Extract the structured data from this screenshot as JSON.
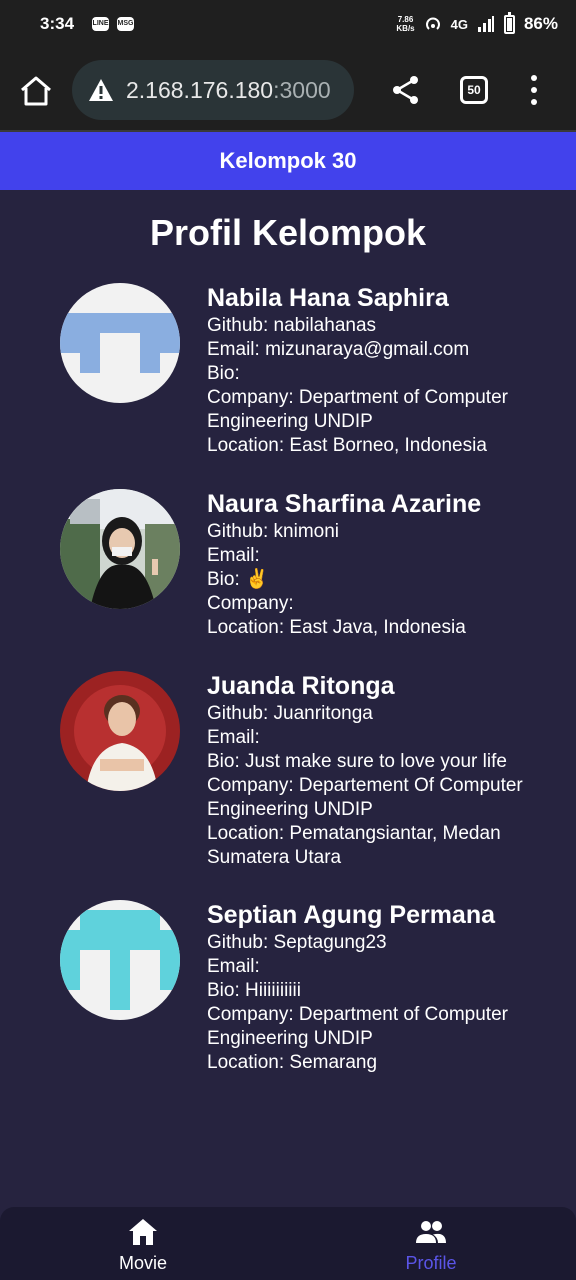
{
  "status_bar": {
    "time": "3:34",
    "notifications": [
      "LINE",
      "MSG"
    ],
    "speed_value": "7.86",
    "speed_unit": "KB/s",
    "network": "4G",
    "battery": "86%"
  },
  "browser": {
    "url_main": "2.168.176.180",
    "url_port": ":3000",
    "tab_count": "50"
  },
  "app": {
    "header_title": "Kelompok 30",
    "page_title": "Profil Kelompok"
  },
  "members": [
    {
      "name": "Nabila Hana Saphira",
      "github": "Github: nabilahanas",
      "email": "Email: mizunaraya@gmail.com",
      "bio": "Bio:",
      "company": "Company: Department of Computer Engineering UNDIP",
      "location": "Location: East Borneo, Indonesia"
    },
    {
      "name": "Naura Sharfina Azarine",
      "github": "Github: knimoni",
      "email": "Email:",
      "bio": "Bio: ✌️",
      "company": "Company:",
      "location": "Location: East Java, Indonesia"
    },
    {
      "name": "Juanda Ritonga",
      "github": "Github: Juanritonga",
      "email": "Email:",
      "bio": "Bio: Just make sure to love your life",
      "company": "Company: Departement Of Computer Engineering UNDIP",
      "location": "Location: Pematangsiantar, Medan Sumatera Utara"
    },
    {
      "name": "Septian Agung Permana",
      "github": "Github: Septagung23",
      "email": "Email:",
      "bio": "Bio: Hiiiiiiiiii",
      "company": "Company: Department of Computer Engineering UNDIP",
      "location": "Location: Semarang"
    }
  ],
  "bottom_nav": {
    "items": [
      {
        "label": "Movie",
        "icon": "home-icon",
        "active": false
      },
      {
        "label": "Profile",
        "icon": "people-icon",
        "active": true
      }
    ]
  },
  "colors": {
    "header": "#4242ec",
    "background": "#26233f",
    "nav_active": "#5b55e8",
    "identicon_blue": "#8aaee0",
    "identicon_cyan": "#5fd2dc"
  }
}
